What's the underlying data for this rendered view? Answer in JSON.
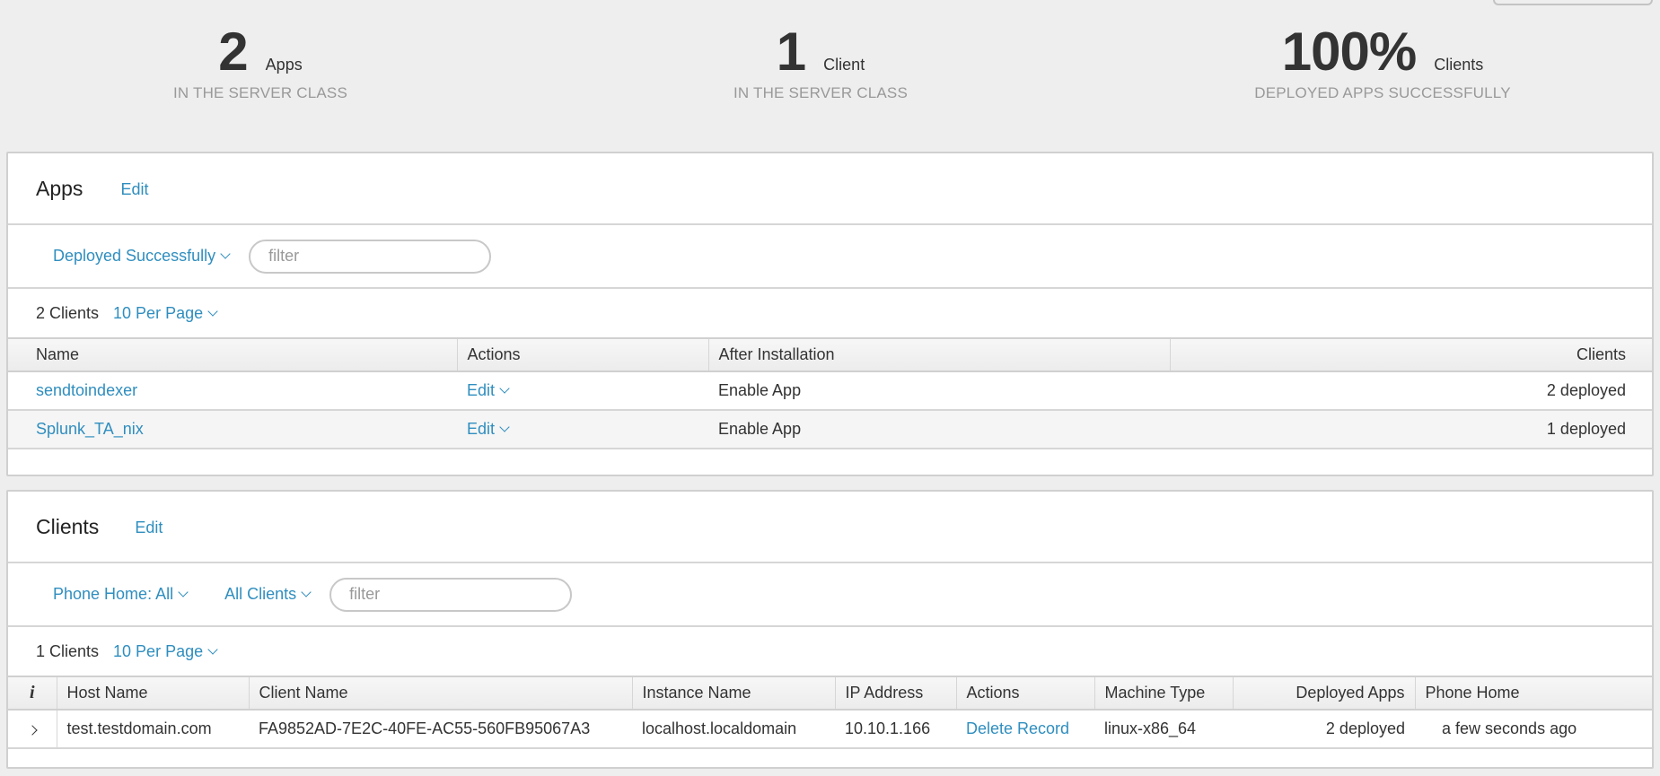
{
  "stats": [
    {
      "value": "2",
      "unit": "Apps",
      "caption": "IN THE SERVER CLASS"
    },
    {
      "value": "1",
      "unit": "Client",
      "caption": "IN THE SERVER CLASS"
    },
    {
      "value": "100%",
      "unit": "Clients",
      "caption": "DEPLOYED APPS SUCCESSFULLY"
    }
  ],
  "apps": {
    "title": "Apps",
    "edit_label": "Edit",
    "status_filter": "Deployed Successfully",
    "filter_placeholder": "filter",
    "count_label": "2 Clients",
    "per_page": "10 Per Page",
    "columns": [
      "Name",
      "Actions",
      "After Installation",
      "Clients"
    ],
    "rows": [
      {
        "name": "sendtoindexer",
        "action": "Edit",
        "after_installation": "Enable App",
        "clients": "2 deployed"
      },
      {
        "name": "Splunk_TA_nix",
        "action": "Edit",
        "after_installation": "Enable App",
        "clients": "1 deployed"
      }
    ]
  },
  "clients": {
    "title": "Clients",
    "edit_label": "Edit",
    "phone_home_filter": "Phone Home: All",
    "clients_filter": "All Clients",
    "filter_placeholder": "filter",
    "count_label": "1 Clients",
    "per_page": "10 Per Page",
    "columns": [
      "i",
      "Host Name",
      "Client Name",
      "Instance Name",
      "IP Address",
      "Actions",
      "Machine Type",
      "Deployed Apps",
      "Phone Home"
    ],
    "rows": [
      {
        "host_name": "test.testdomain.com",
        "client_name": "FA9852AD-7E2C-40FE-AC55-560FB95067A3",
        "instance_name": "localhost.localdomain",
        "ip_address": "10.10.1.166",
        "action": "Delete Record",
        "machine_type": "linux-x86_64",
        "deployed_apps": "2 deployed",
        "phone_home": "a few seconds ago"
      }
    ]
  },
  "colors": {
    "link": "#2f8ebf",
    "background": "#eeeeee",
    "text": "#333333",
    "muted": "#999999"
  }
}
